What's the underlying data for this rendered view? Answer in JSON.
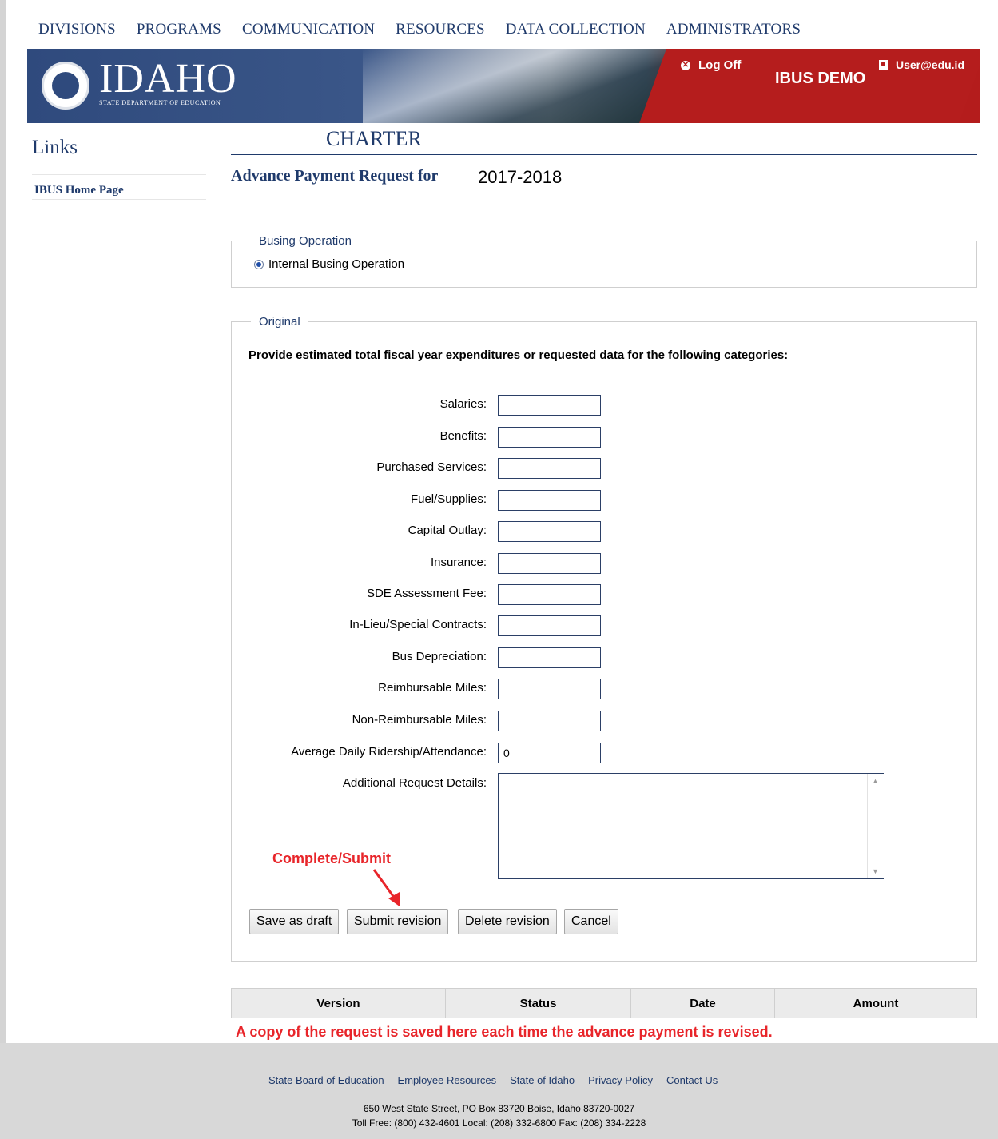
{
  "nav": [
    "DIVISIONS",
    "PROGRAMS",
    "COMMUNICATION",
    "RESOURCES",
    "DATA COLLECTION",
    "ADMINISTRATORS"
  ],
  "banner": {
    "brand": "IDAHO",
    "brand_sub": "STATE DEPARTMENT OF EDUCATION",
    "logoff": "Log Off",
    "app_name": "IBUS DEMO",
    "user": "User@edu.id"
  },
  "sidebar": {
    "title": "Links",
    "items": [
      "IBUS Home Page"
    ]
  },
  "main": {
    "heading": "CHARTER",
    "request_label": "Advance Payment Request for",
    "year": "2017-2018"
  },
  "busing": {
    "legend": "Busing Operation",
    "option": "Internal Busing Operation",
    "selected": true
  },
  "original": {
    "legend": "Original",
    "instructions": "Provide estimated total fiscal year expenditures or requested data for the following categories:",
    "fields": [
      {
        "label": "Salaries:",
        "value": ""
      },
      {
        "label": "Benefits:",
        "value": ""
      },
      {
        "label": "Purchased Services:",
        "value": ""
      },
      {
        "label": "Fuel/Supplies:",
        "value": ""
      },
      {
        "label": "Capital Outlay:",
        "value": ""
      },
      {
        "label": "Insurance:",
        "value": ""
      },
      {
        "label": "SDE Assessment Fee:",
        "value": ""
      },
      {
        "label": "In-Lieu/Special Contracts:",
        "value": ""
      },
      {
        "label": "Bus Depreciation:",
        "value": ""
      },
      {
        "label": "Reimbursable Miles:",
        "value": ""
      },
      {
        "label": "Non-Reimbursable Miles:",
        "value": ""
      },
      {
        "label": "Average Daily Ridership/Attendance:",
        "value": "0"
      }
    ],
    "details_label": "Additional Request Details:",
    "details_value": ""
  },
  "annotations": {
    "submit_hint": "Complete/Submit",
    "copy_note": "A copy of the request is saved here each time the advance payment is revised."
  },
  "buttons": {
    "save_draft": "Save as draft",
    "submit_revision": "Submit revision",
    "delete_revision": "Delete revision",
    "cancel": "Cancel"
  },
  "versions_table": {
    "headers": [
      "Version",
      "Status",
      "Date",
      "Amount"
    ]
  },
  "footer": {
    "links": [
      "State Board of Education",
      "Employee Resources",
      "State of Idaho",
      "Privacy Policy",
      "Contact Us"
    ],
    "address": "650 West State Street, PO Box 83720 Boise, Idaho 83720-0027",
    "phones": "Toll Free: (800) 432-4601 Local: (208) 332-6800 Fax: (208) 334-2228"
  },
  "colors": {
    "navy": "#1f3a6b",
    "banner_blue": "#2f4a7d",
    "banner_red": "#b51d1d",
    "annotation_red": "#e8252a"
  }
}
